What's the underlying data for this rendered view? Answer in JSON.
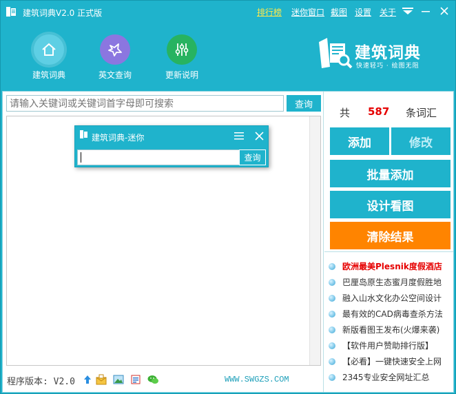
{
  "window": {
    "title": "建筑词典V2.0 正式版",
    "top_links": [
      "排行榜",
      "迷你窗口",
      "截图",
      "设置",
      "关于"
    ]
  },
  "toolbar": {
    "items": [
      {
        "label": "建筑词典",
        "icon": "home-icon"
      },
      {
        "label": "英文查询",
        "icon": "english-query-icon"
      },
      {
        "label": "更新说明",
        "icon": "settings-sliders-icon"
      }
    ]
  },
  "brand": {
    "name": "建筑词典",
    "slogan": "快速轻巧 · 绘图无阻"
  },
  "search": {
    "placeholder": "请输入关键词或关键词首字母即可搜索",
    "button": "查询"
  },
  "mini_window": {
    "title": "建筑词典-迷你",
    "button": "查询"
  },
  "stats": {
    "prefix": "共",
    "count": "587",
    "suffix": "条词汇"
  },
  "actions": {
    "add": "添加",
    "edit": "修改",
    "batch_add": "批量添加",
    "design_view": "设计看图",
    "clear": "清除结果"
  },
  "news": [
    {
      "text": "欧洲最美Plesnik度假酒店",
      "highlight": true
    },
    {
      "text": "巴厘岛原生态蜜月度假胜地",
      "highlight": false
    },
    {
      "text": "融入山水文化办公空间设计",
      "highlight": false
    },
    {
      "text": "最有效的CAD病毒查杀方法",
      "highlight": false
    },
    {
      "text": "新版看图王发布(火爆来袭)",
      "highlight": false
    },
    {
      "text": "【软件用户赞助排行版】",
      "highlight": false
    },
    {
      "text": "【必看】一键快速安全上网",
      "highlight": false
    },
    {
      "text": "2345专业安全网址汇总",
      "highlight": false
    }
  ],
  "footer": {
    "version": "程序版本: V2.0",
    "website": "WWW.SWGZS.COM"
  },
  "colors": {
    "primary": "#1fb3cc",
    "accent_orange": "#ff8400",
    "count_red": "#e60000",
    "link_yellow": "#ffe94a"
  }
}
